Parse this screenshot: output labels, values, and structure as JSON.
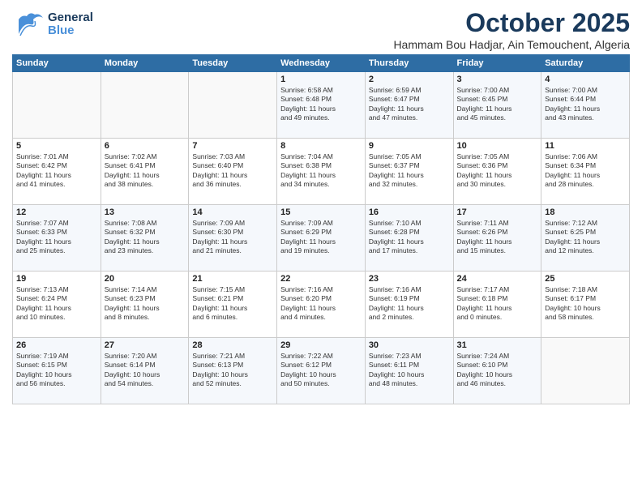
{
  "header": {
    "logo_general": "General",
    "logo_blue": "Blue",
    "title": "October 2025",
    "subtitle": "Hammam Bou Hadjar, Ain Temouchent, Algeria"
  },
  "weekdays": [
    "Sunday",
    "Monday",
    "Tuesday",
    "Wednesday",
    "Thursday",
    "Friday",
    "Saturday"
  ],
  "weeks": [
    [
      {
        "day": "",
        "info": ""
      },
      {
        "day": "",
        "info": ""
      },
      {
        "day": "",
        "info": ""
      },
      {
        "day": "1",
        "info": "Sunrise: 6:58 AM\nSunset: 6:48 PM\nDaylight: 11 hours\nand 49 minutes."
      },
      {
        "day": "2",
        "info": "Sunrise: 6:59 AM\nSunset: 6:47 PM\nDaylight: 11 hours\nand 47 minutes."
      },
      {
        "day": "3",
        "info": "Sunrise: 7:00 AM\nSunset: 6:45 PM\nDaylight: 11 hours\nand 45 minutes."
      },
      {
        "day": "4",
        "info": "Sunrise: 7:00 AM\nSunset: 6:44 PM\nDaylight: 11 hours\nand 43 minutes."
      }
    ],
    [
      {
        "day": "5",
        "info": "Sunrise: 7:01 AM\nSunset: 6:42 PM\nDaylight: 11 hours\nand 41 minutes."
      },
      {
        "day": "6",
        "info": "Sunrise: 7:02 AM\nSunset: 6:41 PM\nDaylight: 11 hours\nand 38 minutes."
      },
      {
        "day": "7",
        "info": "Sunrise: 7:03 AM\nSunset: 6:40 PM\nDaylight: 11 hours\nand 36 minutes."
      },
      {
        "day": "8",
        "info": "Sunrise: 7:04 AM\nSunset: 6:38 PM\nDaylight: 11 hours\nand 34 minutes."
      },
      {
        "day": "9",
        "info": "Sunrise: 7:05 AM\nSunset: 6:37 PM\nDaylight: 11 hours\nand 32 minutes."
      },
      {
        "day": "10",
        "info": "Sunrise: 7:05 AM\nSunset: 6:36 PM\nDaylight: 11 hours\nand 30 minutes."
      },
      {
        "day": "11",
        "info": "Sunrise: 7:06 AM\nSunset: 6:34 PM\nDaylight: 11 hours\nand 28 minutes."
      }
    ],
    [
      {
        "day": "12",
        "info": "Sunrise: 7:07 AM\nSunset: 6:33 PM\nDaylight: 11 hours\nand 25 minutes."
      },
      {
        "day": "13",
        "info": "Sunrise: 7:08 AM\nSunset: 6:32 PM\nDaylight: 11 hours\nand 23 minutes."
      },
      {
        "day": "14",
        "info": "Sunrise: 7:09 AM\nSunset: 6:30 PM\nDaylight: 11 hours\nand 21 minutes."
      },
      {
        "day": "15",
        "info": "Sunrise: 7:09 AM\nSunset: 6:29 PM\nDaylight: 11 hours\nand 19 minutes."
      },
      {
        "day": "16",
        "info": "Sunrise: 7:10 AM\nSunset: 6:28 PM\nDaylight: 11 hours\nand 17 minutes."
      },
      {
        "day": "17",
        "info": "Sunrise: 7:11 AM\nSunset: 6:26 PM\nDaylight: 11 hours\nand 15 minutes."
      },
      {
        "day": "18",
        "info": "Sunrise: 7:12 AM\nSunset: 6:25 PM\nDaylight: 11 hours\nand 12 minutes."
      }
    ],
    [
      {
        "day": "19",
        "info": "Sunrise: 7:13 AM\nSunset: 6:24 PM\nDaylight: 11 hours\nand 10 minutes."
      },
      {
        "day": "20",
        "info": "Sunrise: 7:14 AM\nSunset: 6:23 PM\nDaylight: 11 hours\nand 8 minutes."
      },
      {
        "day": "21",
        "info": "Sunrise: 7:15 AM\nSunset: 6:21 PM\nDaylight: 11 hours\nand 6 minutes."
      },
      {
        "day": "22",
        "info": "Sunrise: 7:16 AM\nSunset: 6:20 PM\nDaylight: 11 hours\nand 4 minutes."
      },
      {
        "day": "23",
        "info": "Sunrise: 7:16 AM\nSunset: 6:19 PM\nDaylight: 11 hours\nand 2 minutes."
      },
      {
        "day": "24",
        "info": "Sunrise: 7:17 AM\nSunset: 6:18 PM\nDaylight: 11 hours\nand 0 minutes."
      },
      {
        "day": "25",
        "info": "Sunrise: 7:18 AM\nSunset: 6:17 PM\nDaylight: 10 hours\nand 58 minutes."
      }
    ],
    [
      {
        "day": "26",
        "info": "Sunrise: 7:19 AM\nSunset: 6:15 PM\nDaylight: 10 hours\nand 56 minutes."
      },
      {
        "day": "27",
        "info": "Sunrise: 7:20 AM\nSunset: 6:14 PM\nDaylight: 10 hours\nand 54 minutes."
      },
      {
        "day": "28",
        "info": "Sunrise: 7:21 AM\nSunset: 6:13 PM\nDaylight: 10 hours\nand 52 minutes."
      },
      {
        "day": "29",
        "info": "Sunrise: 7:22 AM\nSunset: 6:12 PM\nDaylight: 10 hours\nand 50 minutes."
      },
      {
        "day": "30",
        "info": "Sunrise: 7:23 AM\nSunset: 6:11 PM\nDaylight: 10 hours\nand 48 minutes."
      },
      {
        "day": "31",
        "info": "Sunrise: 7:24 AM\nSunset: 6:10 PM\nDaylight: 10 hours\nand 46 minutes."
      },
      {
        "day": "",
        "info": ""
      }
    ]
  ]
}
